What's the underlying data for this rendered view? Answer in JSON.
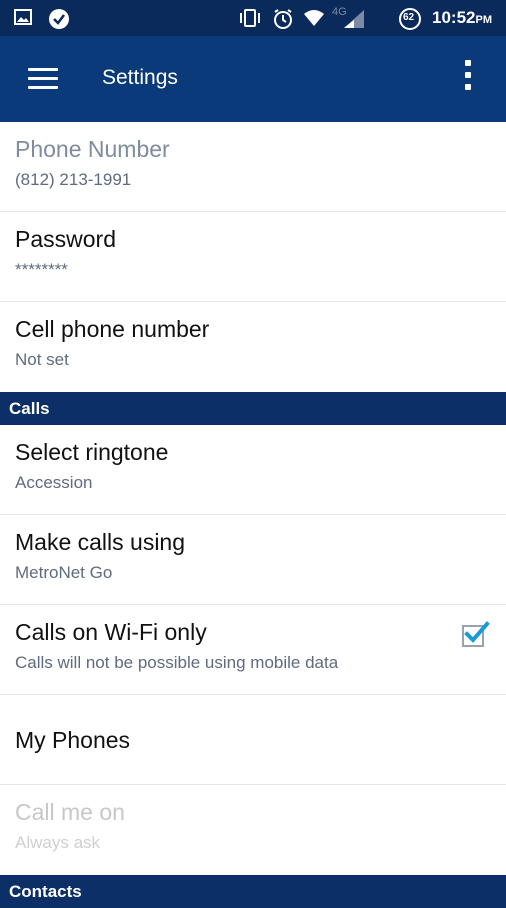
{
  "status_bar": {
    "time": "10:52",
    "ampm": "PM",
    "battery": "62",
    "network": "4G"
  },
  "app_bar": {
    "title": "Settings"
  },
  "account": {
    "phone_number_title": "Phone Number",
    "phone_number_value": "(812) 213-1991",
    "password_title": "Password",
    "password_value": "********",
    "cell_title": "Cell phone number",
    "cell_value": "Not set"
  },
  "calls_section": {
    "header": "Calls",
    "ringtone_title": "Select ringtone",
    "ringtone_value": "Accession",
    "make_calls_title": "Make calls using",
    "make_calls_value": "MetroNet Go",
    "wifi_title": "Calls on Wi-Fi only",
    "wifi_sub": "Calls will not be possible using mobile data",
    "wifi_checked": true,
    "my_phones_title": "My Phones",
    "call_me_title": "Call me on",
    "call_me_value": "Always ask"
  },
  "contacts_section": {
    "header": "Contacts"
  },
  "colors": {
    "app_bar": "#0b3a7a",
    "status_bar": "#0a2a5c",
    "section_header": "#0b2f66",
    "checkbox_accent": "#1a9bd7"
  }
}
